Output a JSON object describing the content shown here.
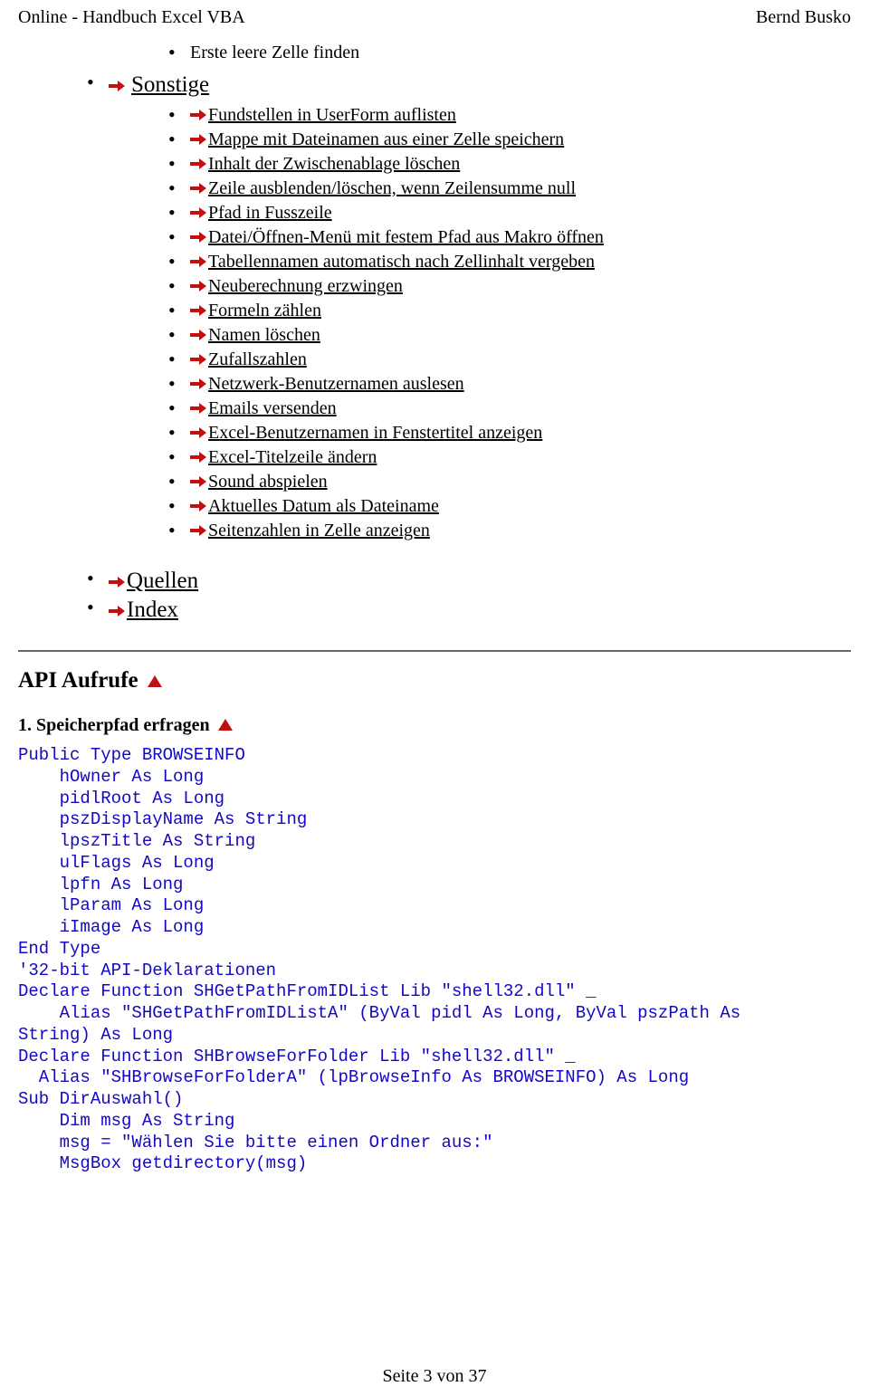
{
  "header": {
    "left": "Online - Handbuch Excel VBA",
    "right": "Bernd Busko"
  },
  "list_top": {
    "item0": "Erste leere Zelle finden"
  },
  "section_sonstige": {
    "title": "Sonstige",
    "items": {
      "i0": "Fundstellen in UserForm auflisten",
      "i1": "Mappe mit Dateinamen aus einer Zelle speichern",
      "i2": "Inhalt der Zwischenablage löschen",
      "i3": "Zeile ausblenden/löschen, wenn Zeilensumme null",
      "i4": "Pfad in Fusszeile",
      "i5": "Datei/Öffnen-Menü mit festem Pfad aus Makro öffnen",
      "i6": "Tabellennamen automatisch nach Zellinhalt vergeben",
      "i7": "Neuberechnung erzwingen",
      "i8": "Formeln zählen",
      "i9": "Namen löschen",
      "i10": "Zufallszahlen",
      "i11": "Netzwerk-Benutzernamen auslesen",
      "i12": "Emails versenden",
      "i13": "Excel-Benutzernamen in Fenstertitel anzeigen",
      "i14": "Excel-Titelzeile ändern",
      "i15": "Sound abspielen",
      "i16": "Aktuelles Datum als Dateiname",
      "i17": "Seitenzahlen in Zelle anzeigen"
    }
  },
  "bottom_links": {
    "l0": "Quellen",
    "l1": "Index"
  },
  "api": {
    "heading": "API Aufrufe",
    "sub": "1. Speicherpfad erfragen",
    "code": "Public Type BROWSEINFO\n    hOwner As Long\n    pidlRoot As Long\n    pszDisplayName As String\n    lpszTitle As String\n    ulFlags As Long\n    lpfn As Long\n    lParam As Long\n    iImage As Long\nEnd Type\n'32-bit API-Deklarationen\nDeclare Function SHGetPathFromIDList Lib \"shell32.dll\" _\n    Alias \"SHGetPathFromIDListA\" (ByVal pidl As Long, ByVal pszPath As\nString) As Long\nDeclare Function SHBrowseForFolder Lib \"shell32.dll\" _\n  Alias \"SHBrowseForFolderA\" (lpBrowseInfo As BROWSEINFO) As Long\nSub DirAuswahl()\n    Dim msg As String\n    msg = \"Wählen Sie bitte einen Ordner aus:\"\n    MsgBox getdirectory(msg)"
  },
  "footer": "Seite 3 von 37"
}
